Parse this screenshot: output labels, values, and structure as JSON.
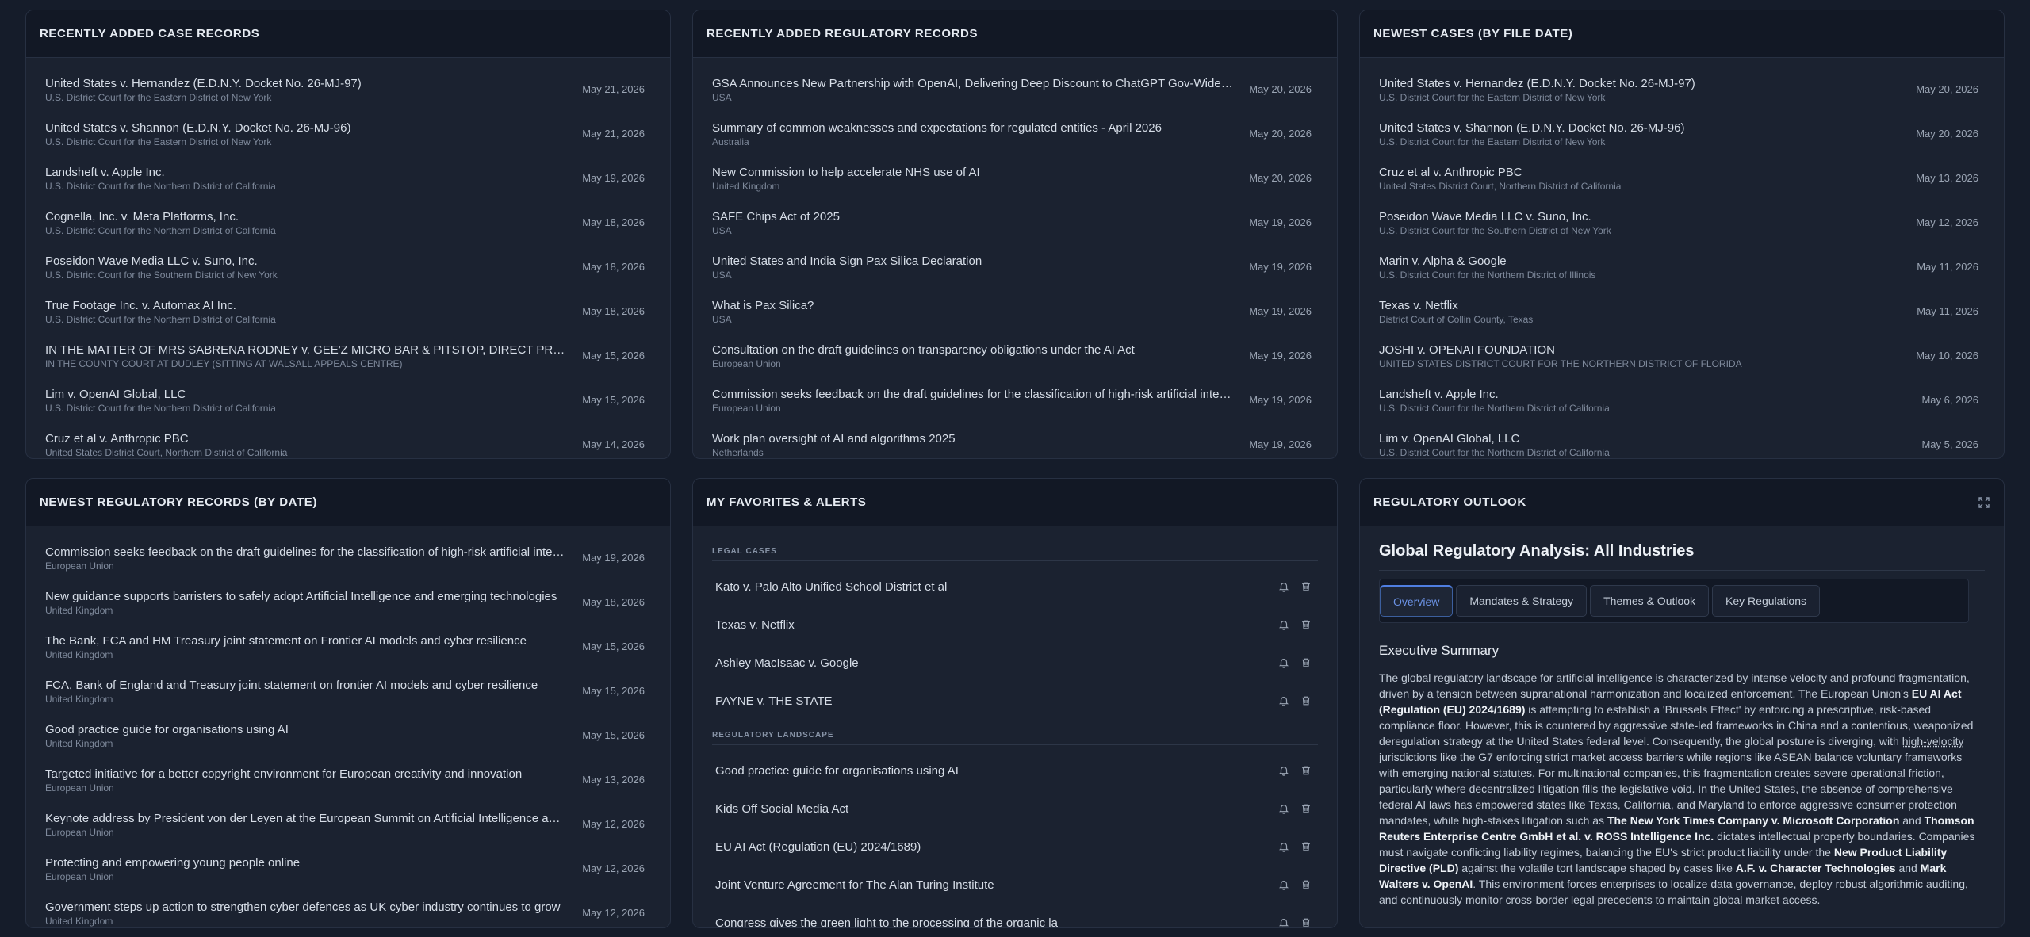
{
  "case_records": {
    "title": "RECENTLY ADDED CASE RECORDS",
    "items": [
      {
        "title": "United States v. Hernandez (E.D.N.Y. Docket No. 26-MJ-97)",
        "sub": "U.S. District Court for the Eastern District of New York",
        "date": "May 21, 2026"
      },
      {
        "title": "United States v. Shannon (E.D.N.Y. Docket No. 26-MJ-96)",
        "sub": "U.S. District Court for the Eastern District of New York",
        "date": "May 21, 2026"
      },
      {
        "title": "Landsheft v. Apple Inc.",
        "sub": "U.S. District Court for the Northern District of California",
        "date": "May 19, 2026"
      },
      {
        "title": "Cognella, Inc. v. Meta Platforms, Inc.",
        "sub": "U.S. District Court for the Northern District of California",
        "date": "May 18, 2026"
      },
      {
        "title": "Poseidon Wave Media LLC v. Suno, Inc.",
        "sub": "U.S. District Court for the Southern District of New York",
        "date": "May 18, 2026"
      },
      {
        "title": "True Footage Inc. v. Automax AI Inc.",
        "sub": "U.S. District Court for the Northern District of California",
        "date": "May 18, 2026"
      },
      {
        "title": "IN THE MATTER OF MRS SABRENA RODNEY v. GEE'Z MICRO BAR & PITSTOP, DIRECT PROPERTY ESTATES LTD",
        "sub": "IN THE COUNTY COURT AT DUDLEY (SITTING AT WALSALL APPEALS CENTRE)",
        "date": "May 15, 2026"
      },
      {
        "title": "Lim v. OpenAI Global, LLC",
        "sub": "U.S. District Court for the Northern District of California",
        "date": "May 15, 2026"
      },
      {
        "title": "Cruz et al v. Anthropic PBC",
        "sub": "United States District Court, Northern District of California",
        "date": "May 14, 2026"
      }
    ]
  },
  "regulatory_records": {
    "title": "RECENTLY ADDED REGULATORY RECORDS",
    "items": [
      {
        "title": "GSA Announces New Partnership with OpenAI, Delivering Deep Discount to ChatGPT Gov-Wide Through MAS",
        "sub": "USA",
        "date": "May 20, 2026"
      },
      {
        "title": "Summary of common weaknesses and expectations for regulated entities - April 2026",
        "sub": "Australia",
        "date": "May 20, 2026"
      },
      {
        "title": "New Commission to help accelerate NHS use of AI",
        "sub": "United Kingdom",
        "date": "May 20, 2026"
      },
      {
        "title": "SAFE Chips Act of 2025",
        "sub": "USA",
        "date": "May 19, 2026"
      },
      {
        "title": "United States and India Sign Pax Silica Declaration",
        "sub": "USA",
        "date": "May 19, 2026"
      },
      {
        "title": "What is Pax Silica?",
        "sub": "USA",
        "date": "May 19, 2026"
      },
      {
        "title": "Consultation on the draft guidelines on transparency obligations under the AI Act",
        "sub": "European Union",
        "date": "May 19, 2026"
      },
      {
        "title": "Commission seeks feedback on the draft guidelines for the classification of high-risk artificial intelligence systems",
        "sub": "European Union",
        "date": "May 19, 2026"
      },
      {
        "title": "Work plan oversight of AI and algorithms 2025",
        "sub": "Netherlands",
        "date": "May 19, 2026"
      }
    ]
  },
  "newest_cases": {
    "title": "NEWEST CASES (BY FILE DATE)",
    "items": [
      {
        "title": "United States v. Hernandez (E.D.N.Y. Docket No. 26-MJ-97)",
        "sub": "U.S. District Court for the Eastern District of New York",
        "date": "May 20, 2026"
      },
      {
        "title": "United States v. Shannon (E.D.N.Y. Docket No. 26-MJ-96)",
        "sub": "U.S. District Court for the Eastern District of New York",
        "date": "May 20, 2026"
      },
      {
        "title": "Cruz et al v. Anthropic PBC",
        "sub": "United States District Court, Northern District of California",
        "date": "May 13, 2026"
      },
      {
        "title": "Poseidon Wave Media LLC v. Suno, Inc.",
        "sub": "U.S. District Court for the Southern District of New York",
        "date": "May 12, 2026"
      },
      {
        "title": "Marin v. Alpha & Google",
        "sub": "U.S. District Court for the Northern District of Illinois",
        "date": "May 11, 2026"
      },
      {
        "title": "Texas v. Netflix",
        "sub": "District Court of Collin County, Texas",
        "date": "May 11, 2026"
      },
      {
        "title": "JOSHI v. OPENAI FOUNDATION",
        "sub": "UNITED STATES DISTRICT COURT FOR THE NORTHERN DISTRICT OF FLORIDA",
        "date": "May 10, 2026"
      },
      {
        "title": "Landsheft v. Apple Inc.",
        "sub": "U.S. District Court for the Northern District of California",
        "date": "May 6, 2026"
      },
      {
        "title": "Lim v. OpenAI Global, LLC",
        "sub": "U.S. District Court for the Northern District of California",
        "date": "May 5, 2026"
      }
    ]
  },
  "newest_regulatory": {
    "title": "NEWEST REGULATORY RECORDS (BY DATE)",
    "items": [
      {
        "title": "Commission seeks feedback on the draft guidelines for the classification of high-risk artificial intelligence systems",
        "sub": "European Union",
        "date": "May 19, 2026"
      },
      {
        "title": "New guidance supports barristers to safely adopt Artificial Intelligence and emerging technologies",
        "sub": "United Kingdom",
        "date": "May 18, 2026"
      },
      {
        "title": "The Bank, FCA and HM Treasury joint statement on Frontier AI models and cyber resilience",
        "sub": "United Kingdom",
        "date": "May 15, 2026"
      },
      {
        "title": "FCA, Bank of England and Treasury joint statement on frontier AI models and cyber resilience",
        "sub": "United Kingdom",
        "date": "May 15, 2026"
      },
      {
        "title": "Good practice guide for organisations using AI",
        "sub": "United Kingdom",
        "date": "May 15, 2026"
      },
      {
        "title": "Targeted initiative for a better copyright environment for European creativity and innovation",
        "sub": "European Union",
        "date": "May 13, 2026"
      },
      {
        "title": "Keynote address by President von der Leyen at the European Summit on Artificial Intelligence and Copyright",
        "sub": "European Union",
        "date": "May 12, 2026"
      },
      {
        "title": "Protecting and empowering young people online",
        "sub": "European Union",
        "date": "May 12, 2026"
      },
      {
        "title": "Government steps up action to strengthen cyber defences as UK cyber industry continues to grow",
        "sub": "United Kingdom",
        "date": "May 12, 2026"
      }
    ]
  },
  "favorites": {
    "title": "MY FAVORITES & ALERTS",
    "legal_label": "LEGAL CASES",
    "legal": [
      "Kato v. Palo Alto Unified School District et al",
      "Texas v. Netflix",
      "Ashley MacIsaac v. Google",
      "PAYNE v. THE STATE"
    ],
    "regulatory_label": "REGULATORY LANDSCAPE",
    "regulatory": [
      "Good practice guide for organisations using AI",
      "Kids Off Social Media Act",
      "EU AI Act (Regulation (EU) 2024/1689)",
      "Joint Venture Agreement for The Alan Turing Institute",
      "Congress gives the green light to the processing of the organic la"
    ]
  },
  "outlook": {
    "title": "REGULATORY OUTLOOK",
    "heading": "Global Regulatory Analysis: All Industries",
    "tabs": [
      "Overview",
      "Mandates & Strategy",
      "Themes & Outlook",
      "Key Regulations"
    ],
    "section": "Executive Summary",
    "p": {
      "t1": "The global regulatory landscape for artificial intelligence is characterized by intense velocity and profound fragmentation, driven by a tension between supranational harmonization and localized enforcement. The European Union's ",
      "b1": "EU AI Act (Regulation (EU) 2024/1689)",
      "t2": " is attempting to establish a 'Brussels Effect' by enforcing a prescriptive, risk-based compliance floor. However, this is countered by aggressive state-led frameworks in China and a contentious, weaponized deregulation strategy at the United States federal level. Consequently, the global posture is diverging, with ",
      "u1": "high-velocity",
      "t3": " jurisdictions like the G7 enforcing strict market access barriers while regions like ASEAN balance voluntary frameworks with emerging national statutes. For multinational companies, this fragmentation creates severe operational friction, particularly where decentralized litigation fills the legislative void. In the United States, the absence of comprehensive federal AI laws has empowered states like Texas, California, and Maryland to enforce aggressive consumer protection mandates, while high-stakes litigation such as ",
      "b2": "The New York Times Company v. Microsoft Corporation",
      "t4": " and ",
      "b3": "Thomson Reuters Enterprise Centre GmbH et al. v. ROSS Intelligence Inc.",
      "t5": " dictates intellectual property boundaries. Companies must navigate conflicting liability regimes, balancing the EU's strict product liability under the ",
      "b4": "New Product Liability Directive (PLD)",
      "t6": " against the volatile tort landscape shaped by cases like ",
      "b5": "A.F. v. Character Technologies",
      "t7": " and ",
      "b6": "Mark Walters v. OpenAI",
      "t8": ". This environment forces enterprises to localize data governance, deploy robust algorithmic auditing, and continuously monitor cross-border legal precedents to maintain global market access."
    }
  },
  "icons": {
    "alert": "bell-icon",
    "delete": "trash-icon",
    "expand": "expand-icon"
  }
}
